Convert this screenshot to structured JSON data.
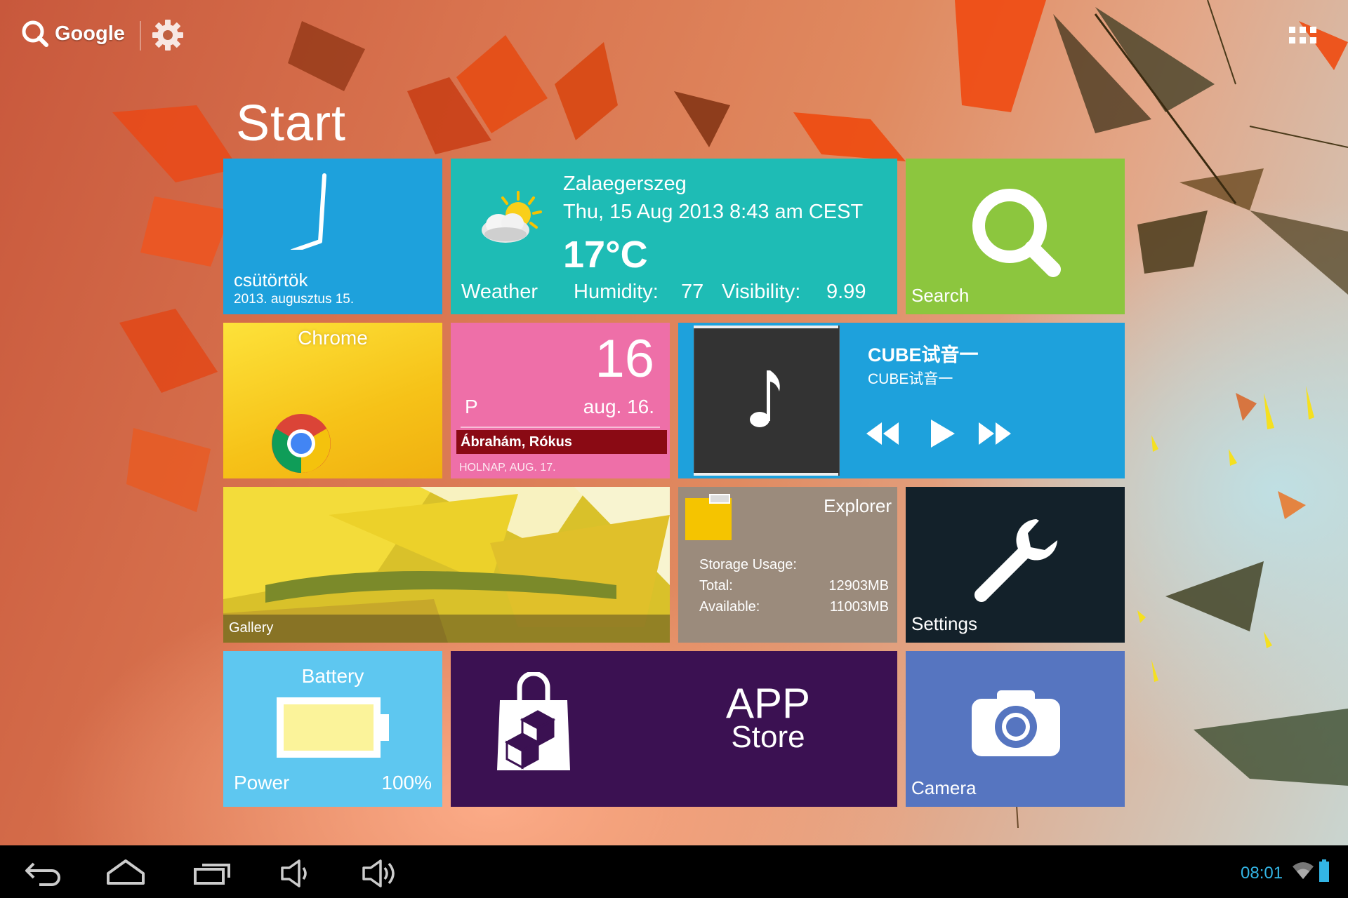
{
  "topbar": {
    "google_label": "Google"
  },
  "start_title": "Start",
  "clock": {
    "day": "csütörtök",
    "date": "2013. augusztus 15."
  },
  "weather": {
    "city": "Zalaegerszeg",
    "datetime": "Thu, 15 Aug 2013 8:43 am CEST",
    "temperature": "17°C",
    "label": "Weather",
    "humidity_label": "Humidity:",
    "humidity_value": "77",
    "visibility_label": "Visibility:",
    "visibility_value": "9.99"
  },
  "search": {
    "label": "Search"
  },
  "chrome": {
    "label": "Chrome"
  },
  "calendar": {
    "day": "16",
    "weekday": "P",
    "month_day": "aug. 16.",
    "event": "Ábrahám, Rókus",
    "next": "HOLNAP, AUG. 17."
  },
  "music": {
    "title": "CUBE试音一",
    "artist": "CUBE试音一"
  },
  "gallery": {
    "label": "Gallery"
  },
  "explorer": {
    "title": "Explorer",
    "storage_label": "Storage Usage:",
    "total_label": "Total:",
    "total_value": "12903MB",
    "available_label": "Available:",
    "available_value": "11003MB"
  },
  "settings": {
    "label": "Settings"
  },
  "battery": {
    "title": "Battery",
    "power_label": "Power",
    "percent": "100%",
    "level": 1.0
  },
  "appstore": {
    "line1": "APP",
    "line2": "Store"
  },
  "camera": {
    "label": "Camera"
  },
  "statusbar": {
    "time": "08:01"
  },
  "colors": {
    "clock_tile": "#1ea1dc",
    "weather_tile": "#1ebcb5",
    "search_tile": "#8cc63e",
    "calendar_tile": "#ee6fa8",
    "calendar_event": "#8a0a14",
    "explorer_tile": "#9b8b7c",
    "settings_tile": "#13212a",
    "battery_tile": "#5ec7f0",
    "appstore_tile": "#3b1152",
    "camera_tile": "#5675c0",
    "status_accent": "#33b5e5"
  },
  "icons": {
    "google_search": "search-icon",
    "settings_top": "gear-icon",
    "apps": "grid-icon",
    "clock": "clock-icon",
    "weather": "partly-cloudy-icon",
    "search": "magnifier-icon",
    "chrome": "chrome-logo-icon",
    "music": "music-note-icon",
    "explorer": "folder-icon",
    "settings": "wrench-icon",
    "battery": "battery-icon",
    "appstore": "shopping-bag-icon",
    "camera": "camera-icon",
    "nav": [
      "back-icon",
      "home-icon",
      "recents-icon",
      "volume-down-icon",
      "volume-up-icon",
      "wifi-icon",
      "battery-status-icon"
    ]
  }
}
